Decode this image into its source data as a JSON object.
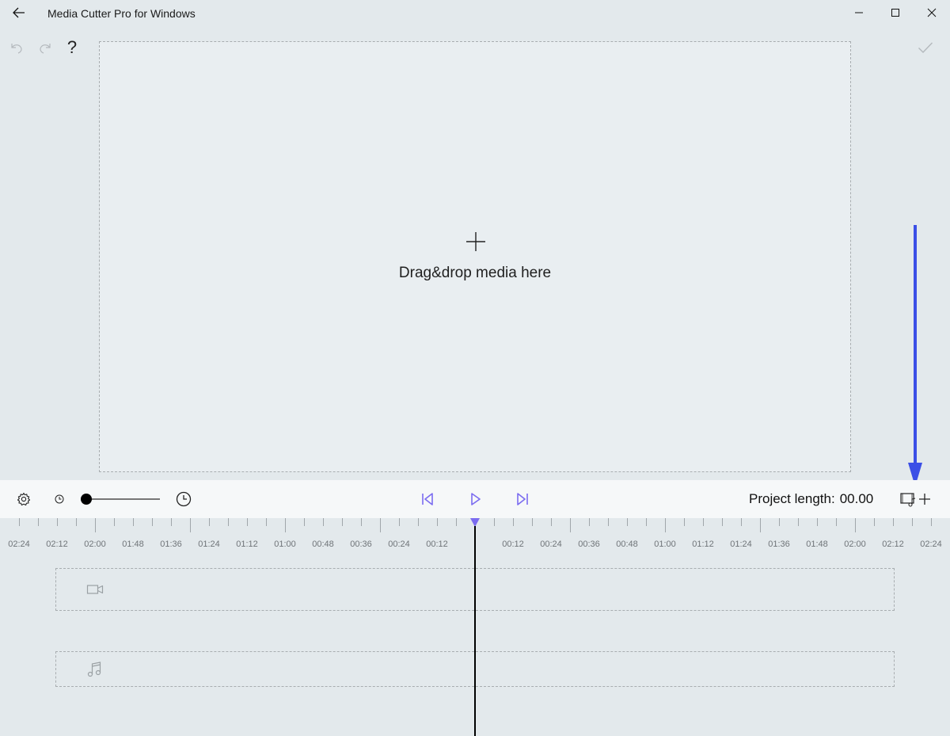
{
  "window": {
    "title": "Media Cutter Pro for Windows"
  },
  "commands": {
    "help_label": "?"
  },
  "drop_zone": {
    "text": "Drag&drop media here"
  },
  "toolbar": {
    "project_length_label": "Project length:",
    "project_length_value": "00.00",
    "zoom_level": 0
  },
  "ruler": {
    "left_labels": [
      "02:24",
      "02:12",
      "02:00",
      "01:48",
      "01:36",
      "01:24",
      "01:12",
      "01:00",
      "00:48",
      "00:36",
      "00:24",
      "00:12"
    ],
    "right_labels": [
      "00:12",
      "00:24",
      "00:36",
      "00:48",
      "01:00",
      "01:12",
      "01:24",
      "01:36",
      "01:48",
      "02:00",
      "02:12",
      "02:24"
    ]
  },
  "colors": {
    "accent": "#7b6cf0",
    "annotation_arrow": "#3b4fe6",
    "background": "#e3e9ec",
    "toolbar": "#f6f8f9"
  },
  "icons": {
    "back": "back-arrow-icon",
    "undo": "undo-icon",
    "redo": "redo-icon",
    "confirm": "checkmark-icon",
    "settings": "gear-icon",
    "add_media": "add-media-icon",
    "video_track": "video-camera-icon",
    "audio_track": "music-note-icon"
  }
}
